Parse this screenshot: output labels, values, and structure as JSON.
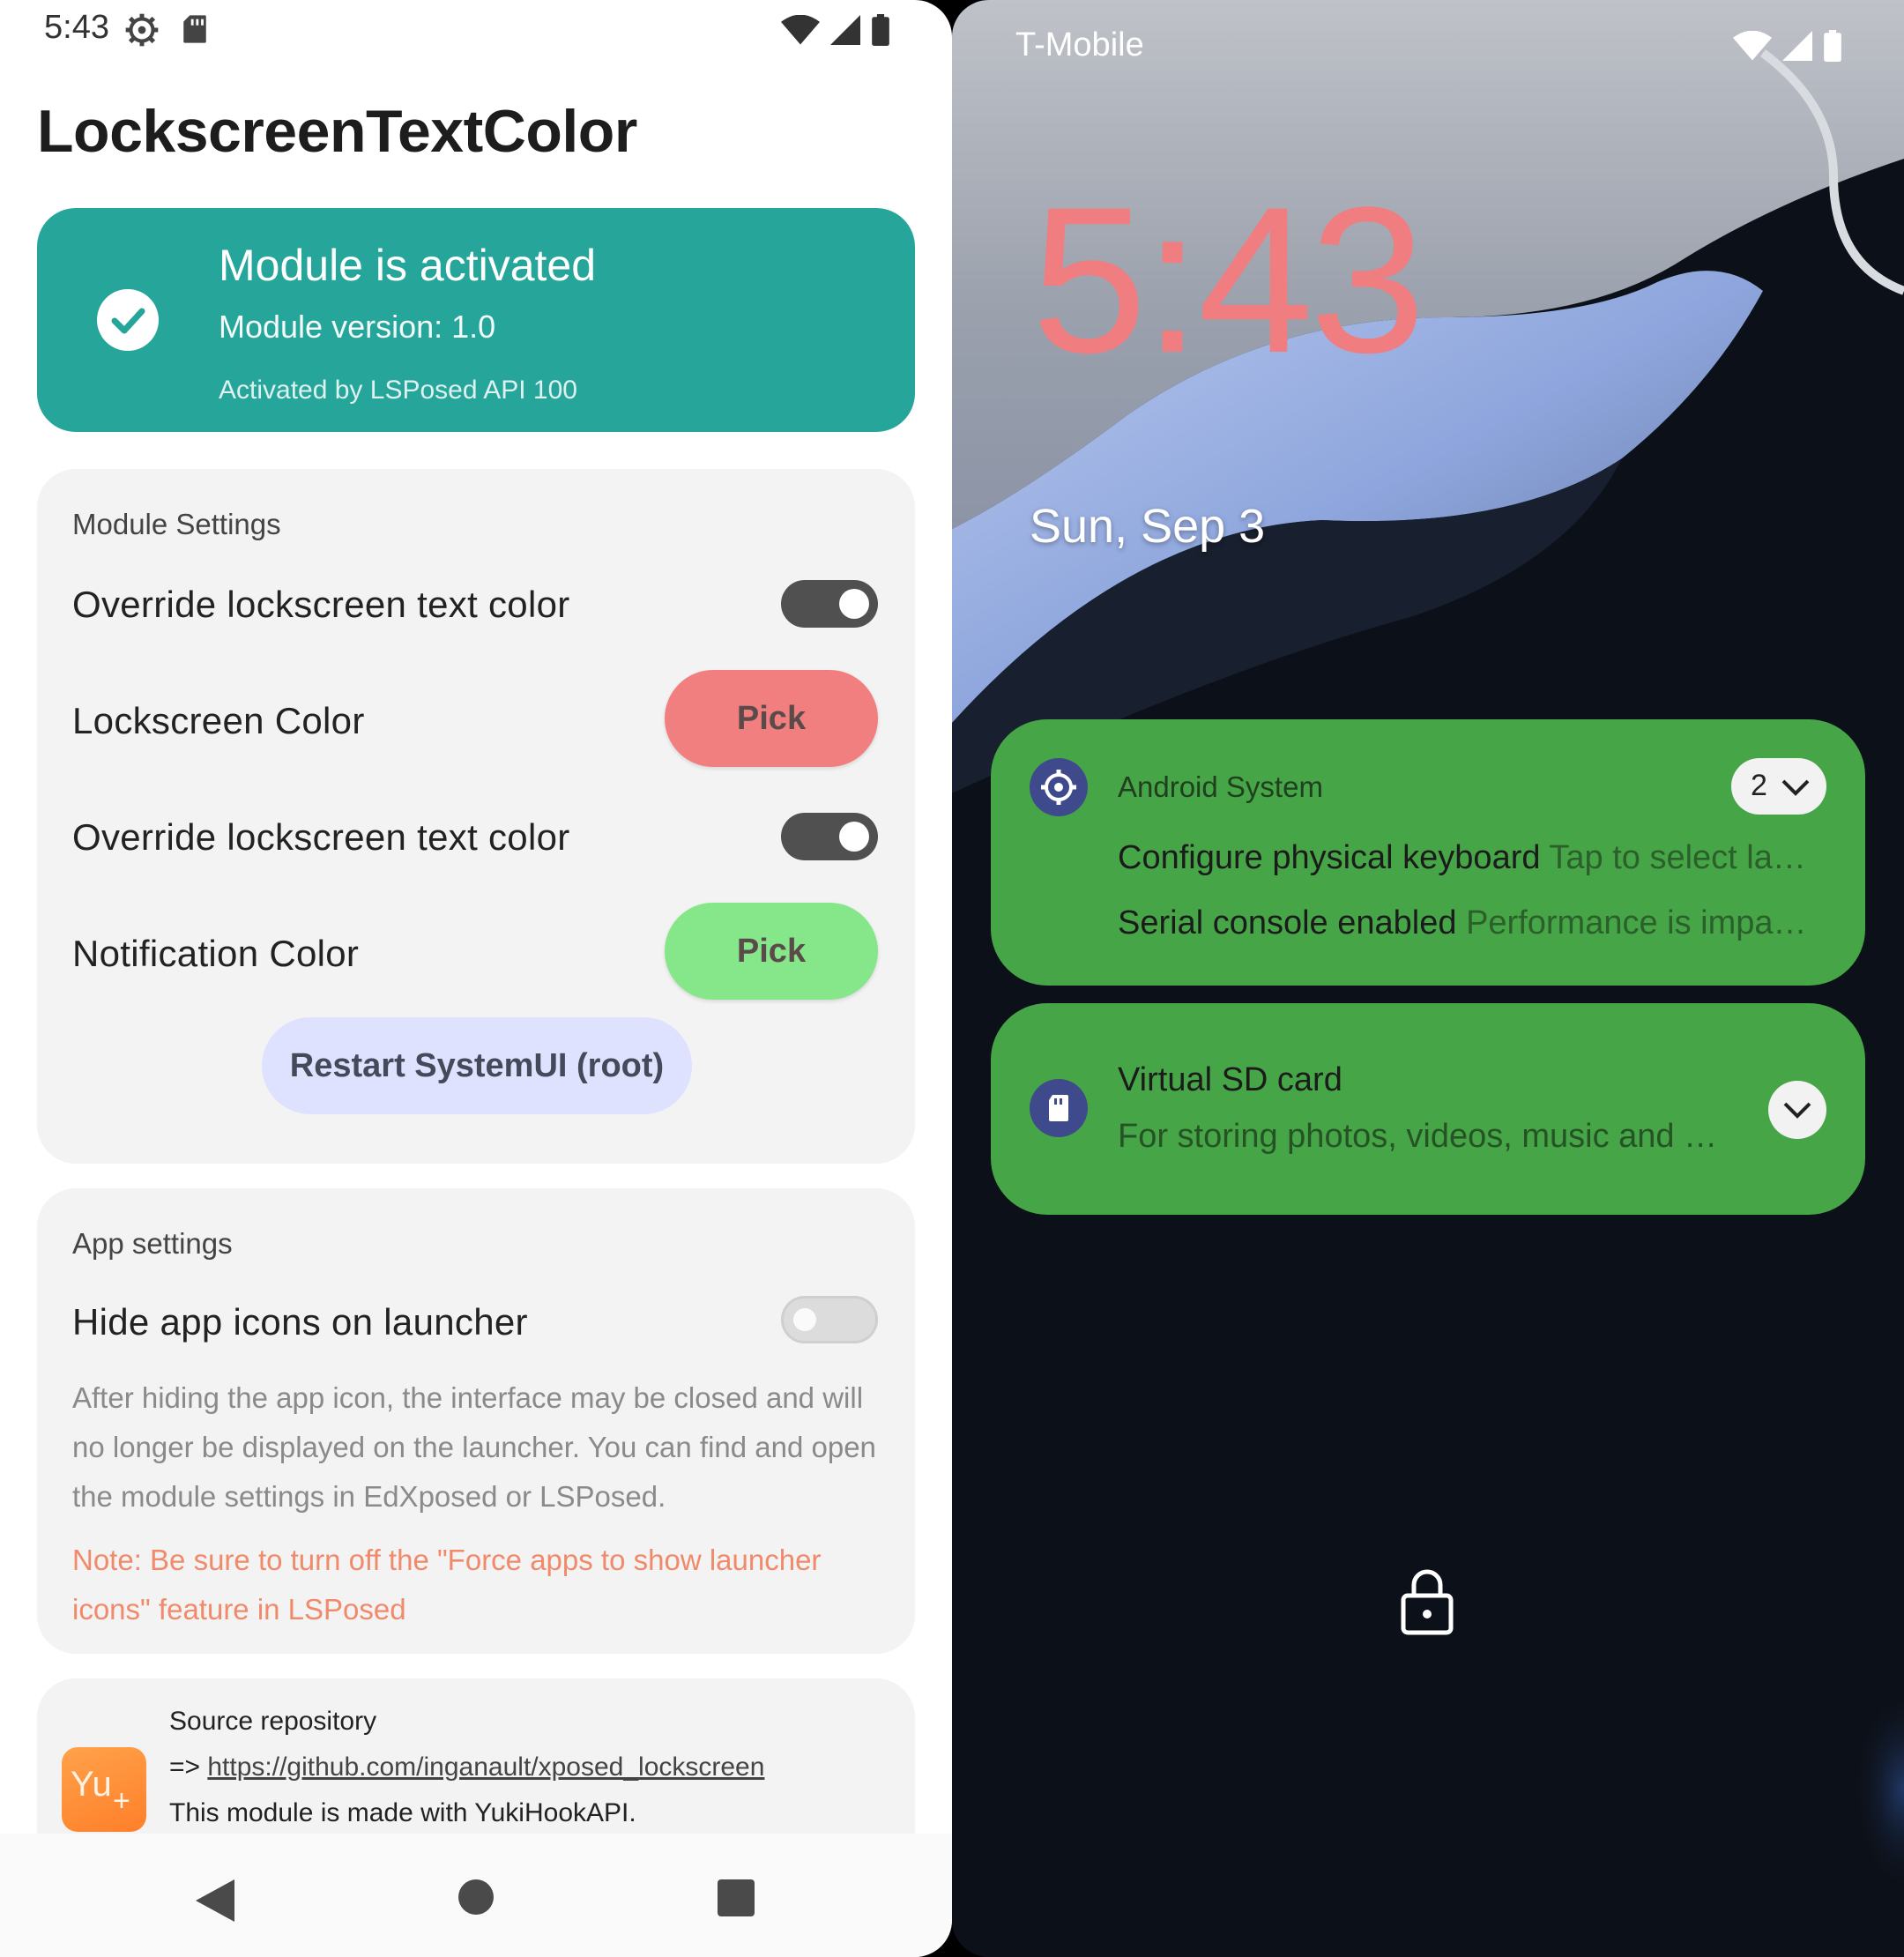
{
  "left_phone": {
    "status_bar": {
      "time": "5:43"
    },
    "app_title": "LockscreenTextColor",
    "status_card": {
      "title": "Module is activated",
      "version": "Module version: 1.0",
      "api": "Activated by LSPosed API 100",
      "color": "#26a69a"
    },
    "module_settings": {
      "heading": "Module Settings",
      "rows": [
        {
          "label": "Override lockscreen text color",
          "type": "toggle",
          "on": true
        },
        {
          "label": "Lockscreen Color",
          "type": "button",
          "button_label": "Pick",
          "color": "#f17f80"
        },
        {
          "label": "Override lockscreen text color",
          "type": "toggle",
          "on": true
        },
        {
          "label": "Notification Color",
          "type": "button",
          "button_label": "Pick",
          "color": "#86e68a"
        }
      ],
      "restart_label": "Restart SystemUI (root)"
    },
    "app_settings": {
      "heading": "App settings",
      "hide_icons_label": "Hide app icons on launcher",
      "hide_icons_on": false,
      "description": "After hiding the app icon, the interface may be closed and will no longer be displayed on the launcher. You can find and open the module settings in EdXposed or LSPosed.",
      "note": "Note: Be sure to turn off the \"Force apps to show launcher icons\" feature in LSPosed"
    },
    "repo_card": {
      "logo_text": "Yu",
      "heading": "Source repository",
      "prefix": "=> ",
      "link": "https://github.com/inganault/xposed_lockscreen",
      "made_with": "This module is made with YukiHookAPI."
    }
  },
  "right_phone": {
    "carrier": "T-Mobile",
    "clock": "5:43",
    "clock_color": "#f07d80",
    "date": "Sun, Sep 3",
    "notification_color": "#46a546",
    "notifications": [
      {
        "app": "Android System",
        "count": "2",
        "lines": [
          {
            "title": "Configure physical keyboard",
            "text": "Tap to select la…"
          },
          {
            "title": "Serial console enabled",
            "text": "Performance is impa…"
          }
        ]
      },
      {
        "title": "Virtual SD card",
        "text": "For storing photos, videos, music and …"
      }
    ]
  }
}
